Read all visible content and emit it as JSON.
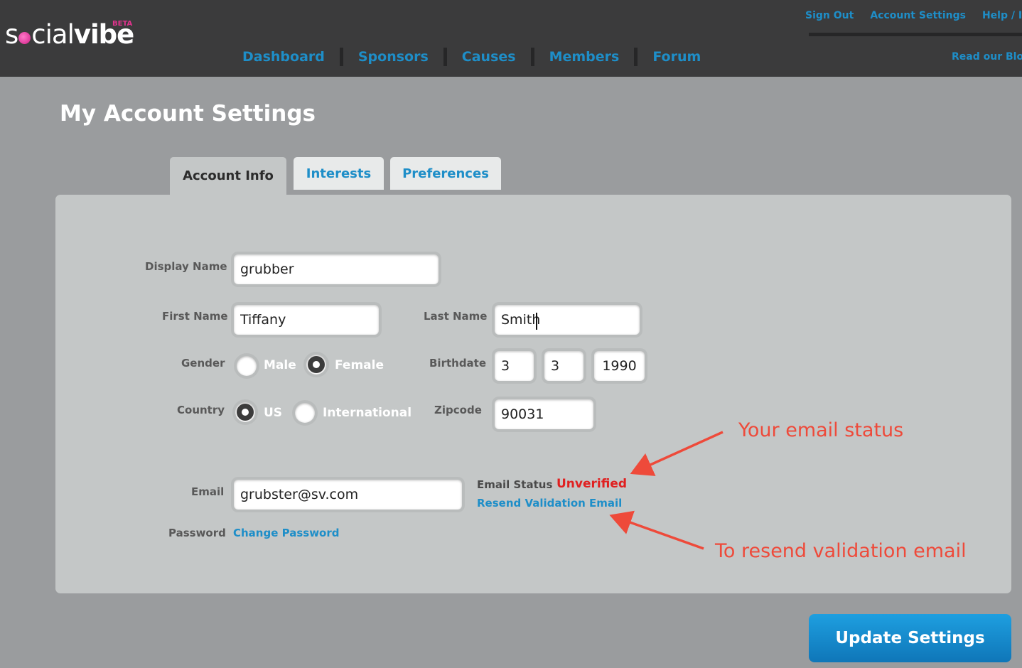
{
  "brand": {
    "logo_left": "s",
    "logo_social": "cial",
    "logo_vibe": "vibe",
    "beta": "BETA",
    "accent_color": "#1e8ec8",
    "logo_color": "#e0338d"
  },
  "nav": {
    "items": [
      "Dashboard",
      "Sponsors",
      "Causes",
      "Members",
      "Forum"
    ]
  },
  "top_links": {
    "sign_out": "Sign Out",
    "account_settings": "Account Settings",
    "help": "Help / Info",
    "blog": "Read our Blog"
  },
  "page": {
    "title": "My Account Settings"
  },
  "tabs": [
    {
      "label": "Account Info",
      "active": true
    },
    {
      "label": "Interests",
      "active": false
    },
    {
      "label": "Preferences",
      "active": false
    }
  ],
  "form": {
    "display_name_label": "Display Name",
    "display_name": "grubber",
    "first_name_label": "First Name",
    "first_name": "Tiffany",
    "last_name_label": "Last Name",
    "last_name": "Smith",
    "gender_label": "Gender",
    "gender_options": [
      "Male",
      "Female"
    ],
    "gender_selected": "Female",
    "birthdate_label": "Birthdate",
    "birth_month": "3",
    "birth_day": "3",
    "birth_year": "1990",
    "country_label": "Country",
    "country_options": [
      "US",
      "International"
    ],
    "country_selected": "US",
    "zipcode_label": "Zipcode",
    "zipcode": "90031",
    "email_label": "Email",
    "email": "grubster@sv.com",
    "email_status_label": "Email Status",
    "email_status": "Unverified",
    "resend_link": "Resend Validation Email",
    "password_label": "Password",
    "change_password_link": "Change Password"
  },
  "annotations": {
    "email_status_note": "Your email status",
    "resend_note": "To resend validation email",
    "color": "#ee4a3a"
  },
  "actions": {
    "update_label": "Update Settings"
  }
}
